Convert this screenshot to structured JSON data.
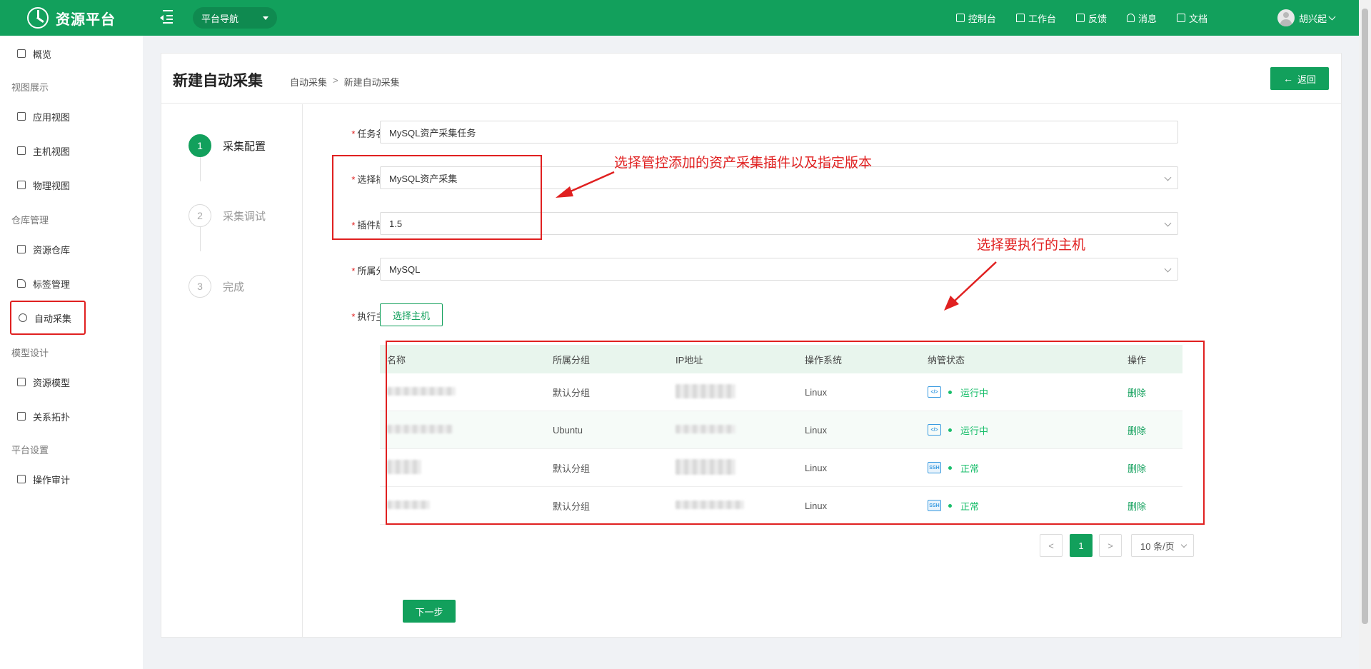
{
  "header": {
    "app_name": "资源平台",
    "platform_nav": "平台导航",
    "links": [
      {
        "label": "控制台",
        "icon": "monitor-icon"
      },
      {
        "label": "工作台",
        "icon": "home-icon"
      },
      {
        "label": "反馈",
        "icon": "document-icon"
      },
      {
        "label": "消息",
        "icon": "bell-icon"
      },
      {
        "label": "文档",
        "icon": "document-icon"
      }
    ],
    "username": "胡兴起"
  },
  "sidebar": {
    "overview": "概览",
    "groups": [
      {
        "title": "视图展示",
        "items": [
          "应用视图",
          "主机视图",
          "物理视图"
        ]
      },
      {
        "title": "仓库管理",
        "items": [
          "资源仓库",
          "标签管理",
          "自动采集"
        ]
      },
      {
        "title": "模型设计",
        "items": [
          "资源模型",
          "关系拓扑"
        ]
      },
      {
        "title": "平台设置",
        "items": [
          "操作审计"
        ]
      }
    ],
    "active_item": "自动采集"
  },
  "page": {
    "title": "新建自动采集",
    "breadcrumb": [
      "自动采集",
      "新建自动采集"
    ],
    "breadcrumb_sep": ">",
    "back_label": "返回",
    "back_arrow": "←"
  },
  "steps": [
    {
      "num": "1",
      "label": "采集配置",
      "active": true
    },
    {
      "num": "2",
      "label": "采集调试",
      "active": false
    },
    {
      "num": "3",
      "label": "完成",
      "active": false
    }
  ],
  "form": {
    "required_mark": "*",
    "task_name_label": "任务名称:",
    "task_name_value": "MySQL资产采集任务",
    "plugin_label": "选择插件:",
    "plugin_value": "MySQL资产采集",
    "version_label": "插件版本:",
    "version_value": "1.5",
    "group_label": "所属分组:",
    "group_value": "MySQL",
    "host_label": "执行主机:",
    "select_host_button": "选择主机"
  },
  "table": {
    "columns": [
      "名称",
      "所属分组",
      "IP地址",
      "操作系统",
      "纳管状态",
      "操作"
    ],
    "rows": [
      {
        "group": "默认分组",
        "os": "Linux",
        "status_icon": "code-icon",
        "status": "运行中",
        "action": "删除"
      },
      {
        "group": "Ubuntu",
        "os": "Linux",
        "status_icon": "code-icon",
        "status": "运行中",
        "action": "删除"
      },
      {
        "group": "默认分组",
        "os": "Linux",
        "status_icon": "ssh-icon",
        "status": "正常",
        "action": "删除"
      },
      {
        "group": "默认分组",
        "os": "Linux",
        "status_icon": "ssh-icon",
        "status": "正常",
        "action": "删除"
      }
    ],
    "code_icon_text": "</>",
    "ssh_icon_text": "SSH"
  },
  "pagination": {
    "prev": "<",
    "current": "1",
    "next": ">",
    "page_size": "10 条/页"
  },
  "next_step_button": "下一步",
  "annotations": {
    "plugin_note": "选择管控添加的资产采集插件以及指定版本",
    "host_note": "选择要执行的主机"
  },
  "colors": {
    "brand": "#12a05c",
    "annotation": "#e02020",
    "status_ok": "#19be6b"
  }
}
